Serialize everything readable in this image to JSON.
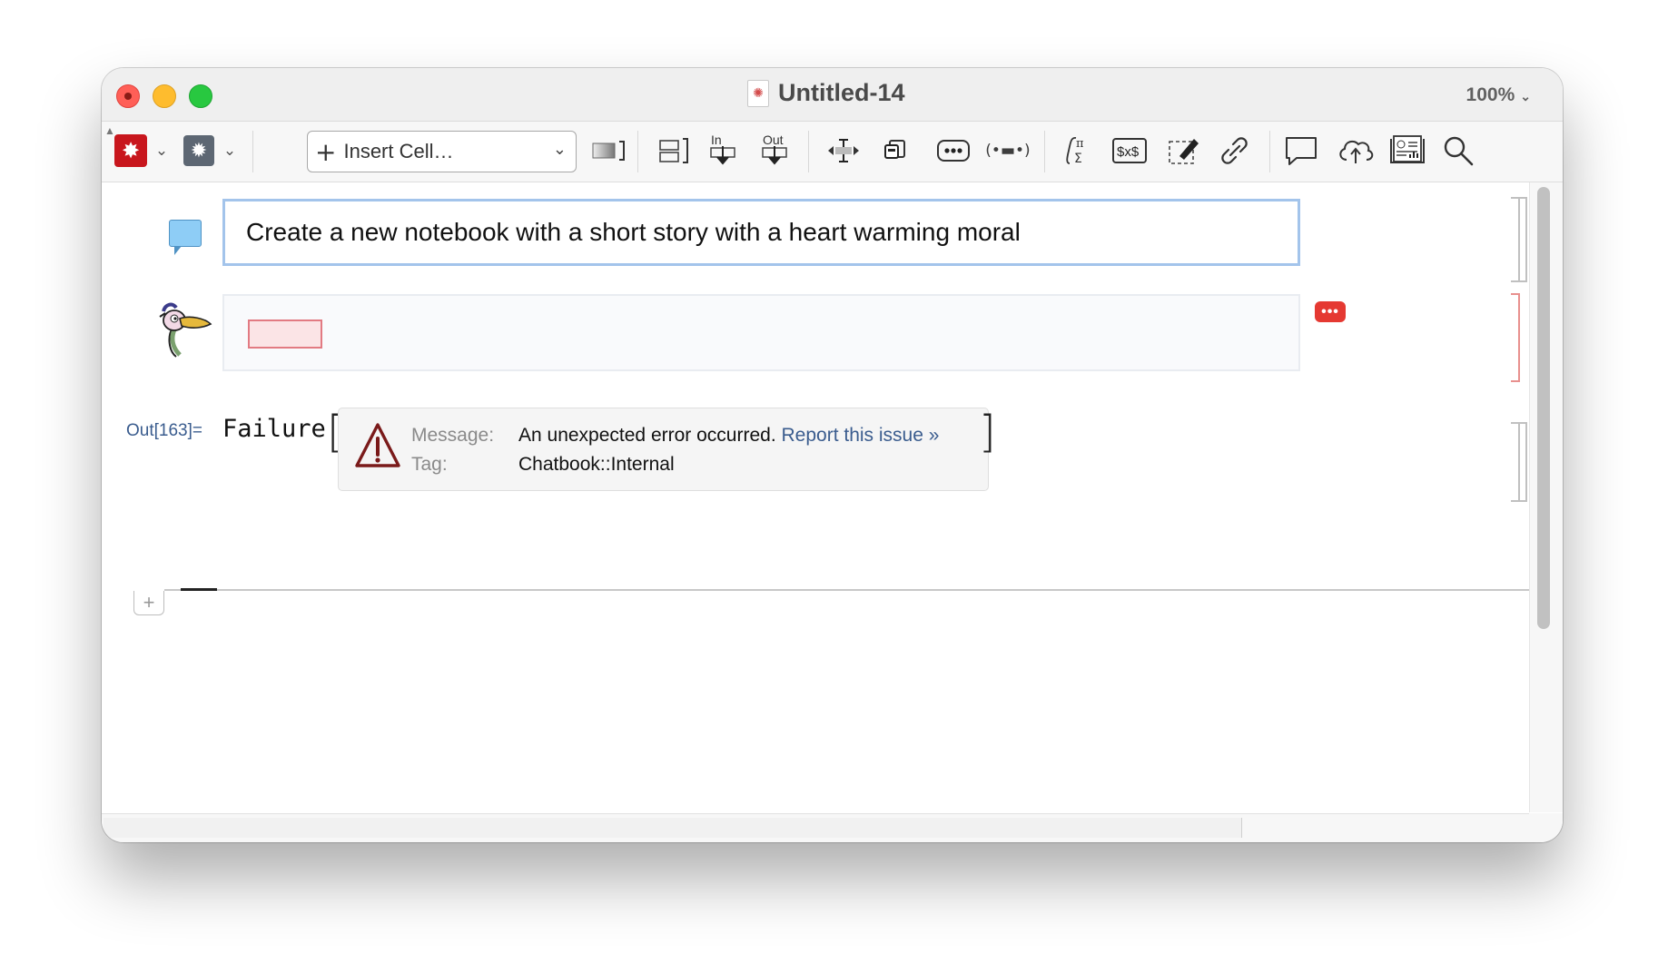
{
  "window": {
    "title": "Untitled-14",
    "zoom_label": "100%",
    "doc_icon": "wolfram-spiky-doc-icon"
  },
  "toolbar": {
    "insert_cell_label": "Insert Cell…",
    "in_label": "In",
    "out_label": "Out",
    "formula_glyph": "∫π\nΣ",
    "dollar_glyph": "$x$",
    "ellipsis_glyph": "•••",
    "tag_glyph": "(•▬•)",
    "icons": [
      "wolfram-red-icon",
      "wolfram-gray-icon",
      "insert-cell-dropdown",
      "frame-icon",
      "split-cell-icon",
      "input-cell-icon",
      "output-cell-icon",
      "resize-icon",
      "copy-icon",
      "ellipsis-icon",
      "tag-icon",
      "formula-icon",
      "inline-math-icon",
      "edit-icon",
      "link-icon",
      "comment-icon",
      "cloud-upload-icon",
      "notebook-icon",
      "search-icon"
    ]
  },
  "notebook": {
    "input_prompt": "Create a new notebook with a short story with a heart warming moral",
    "output_label": "Out[163]=",
    "failure_head": "Failure",
    "message_key": "Message:",
    "message_text": "An unexpected error occurred.",
    "report_link": "Report this issue »",
    "tag_key": "Tag:",
    "tag_value": "Chatbook::Internal",
    "error_badge": "•••",
    "add_cell_glyph": "+"
  },
  "colors": {
    "input_border": "#a3c4eb",
    "error_red": "#e53932",
    "link_blue": "#3a5c8e",
    "warning_dark": "#7a1a1a"
  }
}
